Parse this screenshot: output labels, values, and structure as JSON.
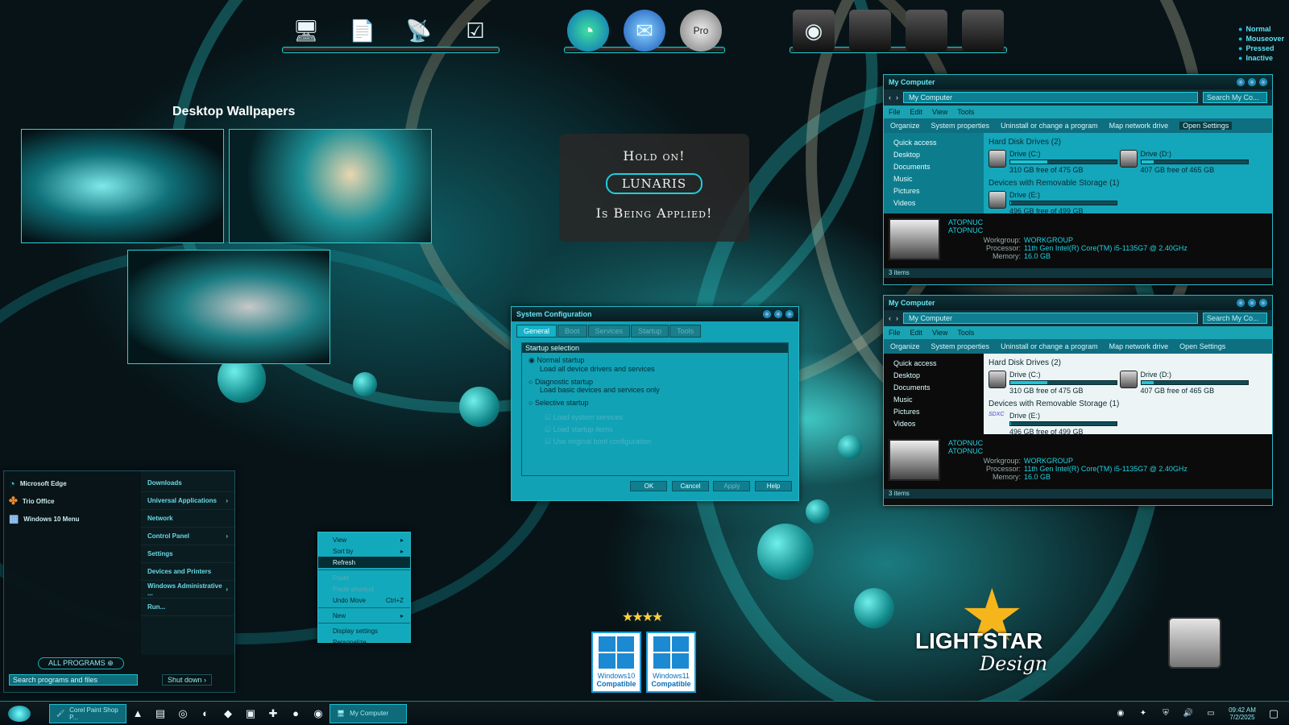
{
  "legend": [
    "Normal",
    "Mouseover",
    "Pressed",
    "Inactive"
  ],
  "wallpapers_title": "Desktop Wallpapers",
  "splash": {
    "line1": "Hold on!",
    "name": "LUNARIS",
    "line2": "Is Being Applied!"
  },
  "explorer": {
    "title": "My Computer",
    "address": "My Computer",
    "search_placeholder": "Search My Co...",
    "menu": [
      "File",
      "Edit",
      "View",
      "Tools"
    ],
    "commands": [
      "Organize",
      "System properties",
      "Uninstall or change a program",
      "Map network drive",
      "Open Settings"
    ],
    "nav": [
      "Quick access",
      "Desktop",
      "Documents",
      "Music",
      "Pictures",
      "Videos"
    ],
    "groups": {
      "hdd": "Hard Disk Drives (2)",
      "removable": "Devices with Removable Storage (1)"
    },
    "drives": [
      {
        "name": "Drive (C:)",
        "free": "310 GB free of 475 GB",
        "used_fraction": 0.35
      },
      {
        "name": "Drive (D:)",
        "free": "407 GB free of 465 GB",
        "used_fraction": 0.12
      },
      {
        "name": "Drive (E:)",
        "free": "496 GB free of 499 GB",
        "used_fraction": 0.01
      }
    ],
    "sdxc": "SDXC",
    "computer_name": "ATOPNUC",
    "computer_sub": "ATOPNUC",
    "details": [
      {
        "label": "Workgroup:",
        "value": "WORKGROUP"
      },
      {
        "label": "Processor:",
        "value": "11th Gen Intel(R) Core(TM) i5-1135G7 @ 2.40GHz"
      },
      {
        "label": "Memory:",
        "value": "16.0 GB"
      }
    ],
    "status": "3 items"
  },
  "sysconfig": {
    "title": "System Configuration",
    "tabs": [
      "General",
      "Boot",
      "Services",
      "Startup",
      "Tools"
    ],
    "section": "Startup selection",
    "options": [
      {
        "label": "Normal startup",
        "desc": "Load all device drivers and services"
      },
      {
        "label": "Diagnostic startup",
        "desc": "Load basic devices and services only"
      },
      {
        "label": "Selective startup",
        "desc": ""
      }
    ],
    "checks": [
      "Load system services",
      "Load startup items",
      "Use original boot configuration"
    ],
    "buttons": [
      "OK",
      "Cancel",
      "Apply",
      "Help"
    ]
  },
  "startmenu": {
    "left": [
      "Microsoft Edge",
      "Trio Office",
      "Windows 10 Menu"
    ],
    "right": [
      "Downloads",
      "Universal Applications",
      "Network",
      "Control Panel",
      "Settings",
      "Devices and Printers",
      "Windows Administrative ...",
      "Run..."
    ],
    "all_programs": "ALL PROGRAMS",
    "search_placeholder": "Search programs and files",
    "shutdown": "Shut down"
  },
  "context": {
    "items": [
      {
        "label": "View",
        "arrow": "▸"
      },
      {
        "label": "Sort by",
        "arrow": "▸"
      },
      {
        "label": "Refresh",
        "arrow": ""
      },
      {
        "label": "Paste",
        "arrow": ""
      },
      {
        "label": "Paste shortcut",
        "arrow": ""
      },
      {
        "label": "Undo Move",
        "arrow": "Ctrl+Z"
      },
      {
        "label": "New",
        "arrow": "▸"
      },
      {
        "label": "Display settings",
        "arrow": ""
      },
      {
        "label": "Personalize",
        "arrow": ""
      }
    ]
  },
  "badges": [
    {
      "ver": "Windows10",
      "txt": "Compatible"
    },
    {
      "ver": "Windows11",
      "txt": "Compatible"
    }
  ],
  "brand": {
    "main": "LIGHTSTAR",
    "sub": "Design"
  },
  "taskbar": {
    "items": [
      "Corel Paint Shop P...",
      "My Computer"
    ],
    "time": "09:42 AM",
    "date": "7/2/2025"
  },
  "colors": {
    "accent": "#15b2c8",
    "dark": "#0d0d0d",
    "text_accent": "#67e4ef"
  }
}
